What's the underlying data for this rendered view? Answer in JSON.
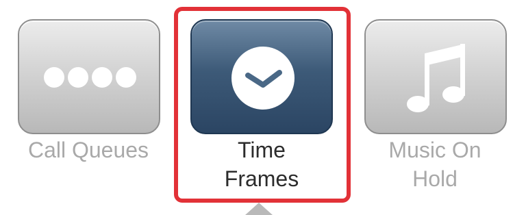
{
  "nav_items": [
    {
      "label": "Call Queues",
      "icon": "dots-icon",
      "active": false
    },
    {
      "label_line1": "Time",
      "label_line2": "Frames",
      "icon": "clock-icon",
      "active": true
    },
    {
      "label_line1": "Music On",
      "label_line2": "Hold",
      "icon": "music-note-icon",
      "active": false
    }
  ],
  "colors": {
    "highlight": "#e23137",
    "active_tile": "#3d5a78",
    "inactive_tile": "#c8c8c8",
    "inactive_label": "#a9a9a9",
    "active_label": "#2c2c2c"
  }
}
